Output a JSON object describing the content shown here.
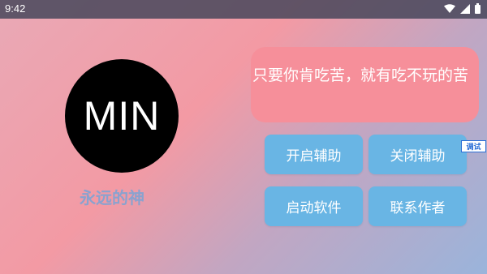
{
  "status_bar": {
    "time": "9:42",
    "icons": [
      "wifi-icon",
      "signal-icon",
      "battery-icon"
    ]
  },
  "profile": {
    "avatar_text": "MIN",
    "subtitle": "永远的神"
  },
  "quote": {
    "text": "只要你肯吃苦，就有吃不玩的苦"
  },
  "buttons": {
    "enable_assist": "开启辅助",
    "disable_assist": "关闭辅助",
    "launch_app": "启动软件",
    "contact_author": "联系作者"
  },
  "debug": {
    "label": "调试"
  },
  "colors": {
    "button_bg": "#69b5e4",
    "quote_bg": "#f68f9a",
    "avatar_bg": "#000000",
    "debug_accent": "#2b6fd6"
  }
}
